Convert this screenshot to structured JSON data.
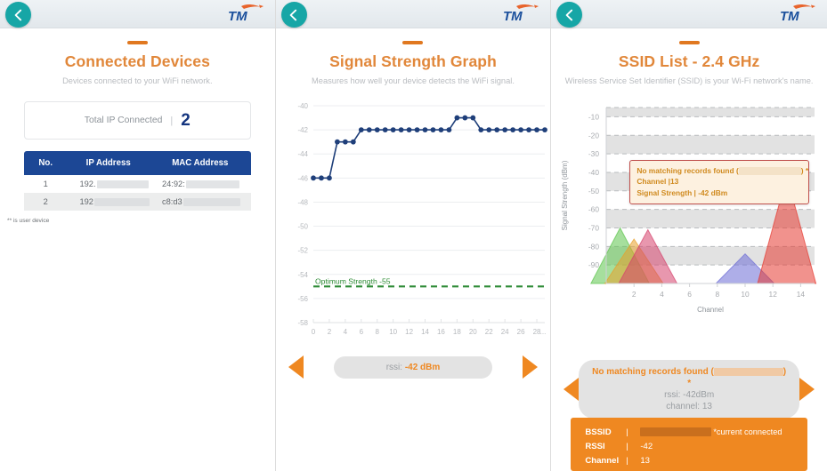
{
  "brand": {
    "logo_text": "TM",
    "logo_color": "#1a4f9c",
    "swoosh_color": "#e8642c",
    "accent": "#ef8821",
    "back_button_color": "#16a6a6"
  },
  "panels": [
    {
      "id": "connected-devices",
      "title": "Connected Devices",
      "subtitle": "Devices connected to your WiFi network.",
      "total": {
        "label": "Total IP Connected",
        "separator": "|",
        "value": "2"
      },
      "table": {
        "headers": [
          "No.",
          "IP Address",
          "MAC Address"
        ],
        "rows": [
          {
            "no": "1",
            "ip": "192.",
            "mac": "24:92:"
          },
          {
            "no": "2",
            "ip": "192",
            "mac": "c8:d3"
          }
        ]
      },
      "footnote": "** is user device"
    },
    {
      "id": "signal-strength-graph",
      "title": "Signal Strength Graph",
      "subtitle": "Measures how well your device detects the WiFi signal.",
      "optimum_label": "Optimum Strength -55",
      "nav": {
        "prev": "previous",
        "next": "next"
      },
      "pill": {
        "prefix": "rssi:",
        "value": "-42 dBm"
      }
    },
    {
      "id": "ssid-list-24",
      "title": "SSID List - 2.4 GHz",
      "subtitle": "Wireless Service Set Identifier (SSID) is your Wi-Fi network's name.",
      "tooltip": {
        "line1_prefix": "No matching records found (",
        "line1_suffix": ") *",
        "line2": "Channel |13",
        "line3": "Signal Strength | -42 dBm"
      },
      "pill": {
        "line1_prefix": "No matching records found (",
        "line1_suffix": ") *",
        "line2": "rssi: -42dBm",
        "line3": "channel: 13"
      },
      "info": {
        "rows": [
          {
            "key": "BSSID",
            "bar": "|",
            "value": "",
            "note": "*current connected"
          },
          {
            "key": "RSSI",
            "bar": "|",
            "value": "-42",
            "note": ""
          },
          {
            "key": "Channel",
            "bar": "|",
            "value": "13",
            "note": ""
          }
        ]
      }
    }
  ],
  "chart_data": [
    {
      "type": "line",
      "id": "rssi-time-series",
      "title": "Signal Strength Graph",
      "xlabel": "",
      "ylabel": "",
      "ylim": [
        -58,
        -40
      ],
      "xlim": [
        0,
        29
      ],
      "yticks": [
        -40,
        -42,
        -44,
        -46,
        -48,
        -50,
        -52,
        -54,
        -56,
        -58
      ],
      "xticks": [
        0,
        2,
        4,
        6,
        8,
        10,
        12,
        14,
        16,
        18,
        20,
        22,
        24,
        26,
        28
      ],
      "xtick_overflow": "...",
      "grid": true,
      "series_color": "#1f3f7a",
      "x": [
        0,
        1,
        2,
        3,
        4,
        5,
        6,
        7,
        8,
        9,
        10,
        11,
        12,
        13,
        14,
        15,
        16,
        17,
        18,
        19,
        20,
        21,
        22,
        23,
        24,
        25,
        26,
        27,
        28,
        29
      ],
      "values": [
        -46,
        -46,
        -46,
        -43,
        -43,
        -43,
        -42,
        -42,
        -42,
        -42,
        -42,
        -42,
        -42,
        -42,
        -42,
        -42,
        -42,
        -42,
        -41,
        -41,
        -41,
        -42,
        -42,
        -42,
        -42,
        -42,
        -42,
        -42,
        -42,
        -42
      ],
      "threshold": {
        "value": -55,
        "label": "Optimum Strength -55",
        "color": "#2e8b36",
        "dashed": true
      }
    },
    {
      "type": "area",
      "id": "ssid-channel-spectrum",
      "title": "SSID List - 2.4 GHz",
      "xlabel": "Channel",
      "ylabel": "Signal Strength (dBm)",
      "ylim": [
        -100,
        -5
      ],
      "xlim": [
        0,
        15
      ],
      "yticks": [
        -10,
        -20,
        -30,
        -40,
        -50,
        -60,
        -70,
        -80,
        -90
      ],
      "xticks": [
        2,
        4,
        6,
        8,
        10,
        12,
        14
      ],
      "grid": true,
      "networks": [
        {
          "channel": 1,
          "signal": -70,
          "color": "#5cc44c",
          "label": ""
        },
        {
          "channel": 2,
          "signal": -76,
          "color": "#e8a02a",
          "label": ""
        },
        {
          "channel": 3,
          "signal": -71,
          "color": "#d6426c",
          "label": ""
        },
        {
          "channel": 10,
          "signal": -84,
          "color": "#6b6bd6",
          "label": ""
        },
        {
          "channel": 13,
          "signal": -42,
          "color": "#e5392f",
          "label": "current connected",
          "selected": true
        }
      ]
    }
  ]
}
